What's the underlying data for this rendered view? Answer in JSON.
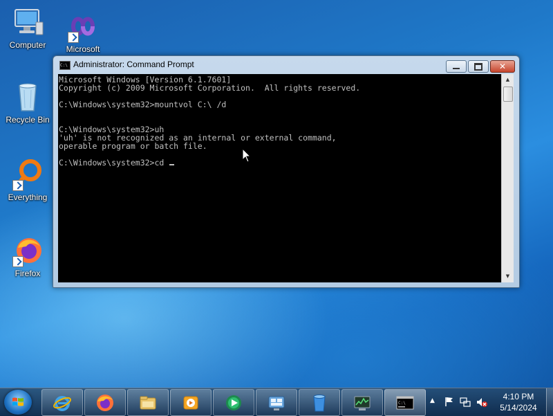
{
  "desktop": {
    "icons": [
      {
        "label": "Computer"
      },
      {
        "label": "Microsoft"
      },
      {
        "label": "Recycle Bin"
      },
      {
        "label": "Everything"
      },
      {
        "label": "Firefox"
      }
    ]
  },
  "window": {
    "title": "Administrator: Command Prompt",
    "title_icon_text": "C:\\",
    "close_glyph": "✕",
    "console": {
      "lines": [
        "Microsoft Windows [Version 6.1.7601]",
        "Copyright (c) 2009 Microsoft Corporation.  All rights reserved.",
        "",
        "C:\\Windows\\system32>mountvol C:\\ /d",
        "",
        "",
        "C:\\Windows\\system32>uh",
        "'uh' is not recognized as an internal or external command,",
        "operable program or batch file.",
        "",
        "C:\\Windows\\system32>cd "
      ]
    },
    "scrollbar": {
      "up": "▲",
      "down": "▼"
    }
  },
  "taskbar": {
    "buttons": [
      {
        "icon": "internet-explorer-icon"
      },
      {
        "icon": "firefox-icon"
      },
      {
        "icon": "windows-explorer-icon"
      },
      {
        "icon": "media-player-icon"
      },
      {
        "icon": "media-center-icon"
      },
      {
        "icon": "control-panel-icon"
      },
      {
        "icon": "recycle-bin-icon"
      },
      {
        "icon": "performance-monitor-icon"
      },
      {
        "icon": "command-prompt-icon"
      }
    ],
    "tray": {
      "chevron": "▲",
      "time": "4:10 PM",
      "date": "5/14/2024"
    }
  },
  "colors": {
    "console_bg": "#000000",
    "console_fg": "#c0c0c0",
    "desktop_blue": "#1f79c9",
    "close_button": "#c7452d"
  }
}
